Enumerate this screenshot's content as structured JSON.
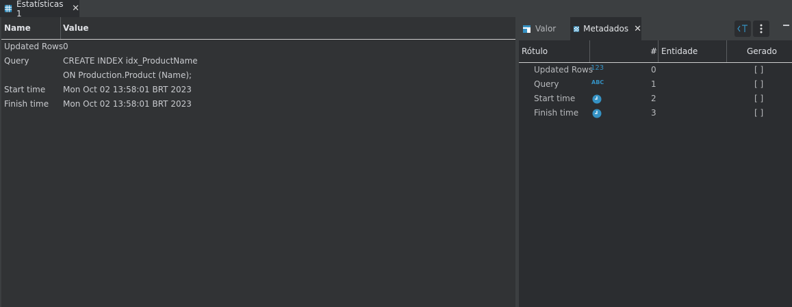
{
  "main_tab": {
    "label": "Estatísticas 1",
    "icon": "grid-icon"
  },
  "stats": {
    "headers": {
      "name": "Name",
      "value": "Value"
    },
    "rows": [
      {
        "name": "Updated Rows",
        "value": "0"
      },
      {
        "name": "Query",
        "value": "CREATE INDEX idx_ProductName"
      },
      {
        "name": "",
        "value": "ON Production.Product (Name);"
      },
      {
        "name": "Start time",
        "value": "Mon Oct 02 13:58:01 BRT 2023"
      },
      {
        "name": "Finish time",
        "value": "Mon Oct 02 13:58:01 BRT 2023"
      }
    ]
  },
  "side_panel": {
    "tabs": [
      {
        "label": "Valor",
        "icon": "value-panel-icon"
      },
      {
        "label": "Metadados",
        "icon": "metadata-icon",
        "active": true
      }
    ],
    "headers": {
      "label": "Rótulo",
      "index": "#",
      "entity": "Entidade",
      "generated": "Gerado"
    },
    "rows": [
      {
        "label": "Updated Rows",
        "type_icon": "number-type-icon",
        "type_text": "123",
        "index": "0",
        "generated": "[ ]"
      },
      {
        "label": "Query",
        "type_icon": "string-type-icon",
        "type_text": "ABC",
        "index": "1",
        "generated": "[ ]"
      },
      {
        "label": "Start time",
        "type_icon": "clock-icon",
        "type_text": "",
        "index": "2",
        "generated": "[ ]"
      },
      {
        "label": "Finish time",
        "type_icon": "clock-icon",
        "type_text": "",
        "index": "3",
        "generated": "[ ]"
      }
    ]
  },
  "colors": {
    "accent": "#3592c4",
    "background": "#2b2d30",
    "panel": "#313335"
  }
}
